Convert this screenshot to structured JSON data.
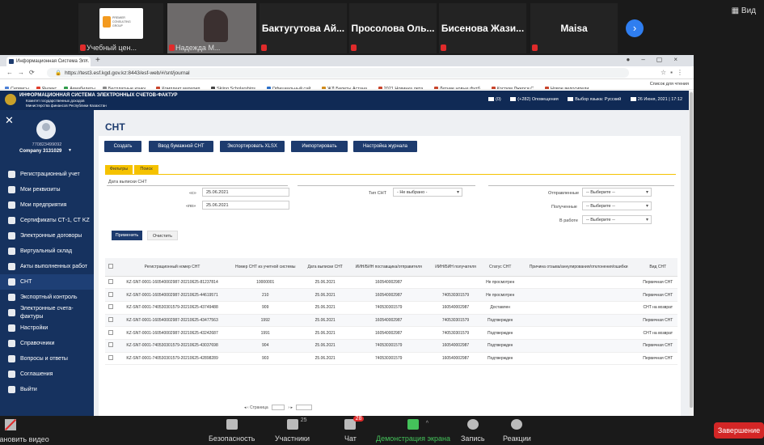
{
  "zoom_top": {
    "tiles": [
      {
        "name": "Учебный цен..."
      },
      {
        "name": "Надежда М..."
      },
      {
        "name": "Бактугутова Ай..."
      },
      {
        "name": "Просолова Оль..."
      },
      {
        "name": "Бисенова Жази..."
      },
      {
        "name": "Maisa"
      }
    ],
    "logo_text": "PREMIER CONSULTING GROUP",
    "view_label": "Вид"
  },
  "browser": {
    "tab_title": "Информационная Система Эл...",
    "url": "https://test3.esf.kgd.gov.kz:8443/esf-web/#/snt/journal",
    "bookmarks": [
      {
        "label": "Сервисы",
        "color": "#4a7fd6"
      },
      {
        "label": "Яндекс",
        "color": "#e03b2b"
      },
      {
        "label": "Авиабилеты",
        "color": "#2f9b4a"
      },
      {
        "label": "Бесплатные конку...",
        "color": "#888888"
      },
      {
        "label": "Комплект материп...",
        "color": "#c8432a"
      },
      {
        "label": "Skiing Scholarships...",
        "color": "#444444"
      },
      {
        "label": "Официальный сай...",
        "color": "#2a6fc8"
      },
      {
        "label": "ЖД Билеты Астана...",
        "color": "#d08a1a"
      },
      {
        "label": "2021 Новинка лета...",
        "color": "#c8432a"
      },
      {
        "label": "Летние новые футб...",
        "color": "#c8432a"
      },
      {
        "label": "Костюм Джерси С...",
        "color": "#c8432a"
      },
      {
        "label": "Новое велосипеди...",
        "color": "#c8432a"
      }
    ],
    "reading_list": "Список для чтения"
  },
  "app": {
    "org_line1": "ИНФОРМАЦИОННАЯ СИСТЕМА ЭЛЕКТРОННЫХ СЧЕТОВ-ФАКТУР",
    "org_line2": "Комитет государственных доходов",
    "org_line3": "Министерства финансов Республики Казахстан",
    "messages": "(0)",
    "notifications": "(+282) Оповещения",
    "language": "Выбор языка: Русский",
    "datetime": "26 Июня, 2021 | 17:12"
  },
  "sidebar": {
    "user_id": "770823499092",
    "company": "Company 3131029",
    "items": [
      {
        "label": "Регистрационный учет"
      },
      {
        "label": "Мои реквизиты"
      },
      {
        "label": "Мои предприятия"
      },
      {
        "label": "Сертификаты СТ-1, СТ KZ"
      },
      {
        "label": "Электронные договоры"
      },
      {
        "label": "Виртуальный склад"
      },
      {
        "label": "Акты выполненных работ"
      },
      {
        "label": "СНТ"
      },
      {
        "label": "Экспортный контроль"
      },
      {
        "label": "Электронные счета-фактуры"
      },
      {
        "label": "Настройки"
      },
      {
        "label": "Справочники"
      },
      {
        "label": "Вопросы и ответы"
      },
      {
        "label": "Соглашения"
      },
      {
        "label": "Выйти"
      }
    ]
  },
  "page": {
    "title": "СНТ",
    "buttons": [
      "Создать",
      "Ввод бумажной СНТ",
      "Экспортировать XLSX",
      "Импортировать",
      "Настройка журнала"
    ],
    "filter_tabs": [
      "Фильтры",
      "Поиск"
    ],
    "filters": {
      "date_label": "Дата выписки СНТ",
      "from_label": "«с»",
      "from_value": "25.06.2021",
      "to_label": "«по»",
      "to_value": "25.06.2021",
      "type_label": "Тип СНТ",
      "type_value": "- Не выбрано -",
      "sent_label": "Отправленные",
      "sent_value": "-- Выберите --",
      "received_label": "Полученные",
      "received_value": "-- Выберите --",
      "inwork_label": "В работе",
      "inwork_value": "-- Выберите --",
      "apply": "Применить",
      "clear": "Очистить"
    },
    "table": {
      "columns": [
        "Регистрационный номер СНТ",
        "Номер СНТ из учетной системы",
        "Дата выписки СНТ",
        "ИИН/БИН поставщика/отправителя",
        "ИИН/БИН получателя",
        "Статус СНТ",
        "Причина отзыва/аннулирования/отклонения/ошибки",
        "Вид СНТ"
      ],
      "rows": [
        [
          "KZ-SNT-0001-160540002987-20210625-81237814",
          "10000001",
          "25.06.2021",
          "160540002987",
          "",
          "Не просмотрен",
          "",
          "Первичная СНТ"
        ],
        [
          "KZ-SNT-0001-160540002987-20210625-44619571",
          "210",
          "25.06.2021",
          "160540002987",
          "740530301579",
          "Не просмотрен",
          "",
          "Первичная СНТ"
        ],
        [
          "KZ-SNT-0001-740530301579-20210625-43749488",
          "909",
          "25.06.2021",
          "740530301579",
          "160540002987",
          "Доставлен",
          "",
          "СНТ на возврат"
        ],
        [
          "KZ-SNT-0001-160540002987-20210625-43477563",
          "1992",
          "25.06.2021",
          "160540002987",
          "740530301579",
          "Подтвержден",
          "",
          "Первичная СНТ"
        ],
        [
          "KZ-SNT-0001-160540002987-20210625-43242687",
          "1991",
          "25.06.2021",
          "160540002987",
          "740530301579",
          "Подтвержден",
          "",
          "СНТ на возврат"
        ],
        [
          "KZ-SNT-0001-740530301579-20210625-43037698",
          "904",
          "25.06.2021",
          "740530301579",
          "160540002987",
          "Подтвержден",
          "",
          "Первичная СНТ"
        ],
        [
          "KZ-SNT-0001-740530301579-20210625-42898289",
          "903",
          "25.06.2021",
          "740530301579",
          "160540002987",
          "Подтвержден",
          "",
          "Первичная СНТ"
        ]
      ]
    },
    "pager": {
      "label": "Страница",
      "page": "1",
      "per_page": "10"
    }
  },
  "zoom_bottom": {
    "stop_video": "Остановить видео",
    "security": "Безопасность",
    "participants": "Участники",
    "participants_count": "25",
    "chat": "Чат",
    "chat_count": "28",
    "share": "Демонстрация экрана",
    "record": "Запись",
    "reactions": "Реакции",
    "end": "Завершение"
  }
}
